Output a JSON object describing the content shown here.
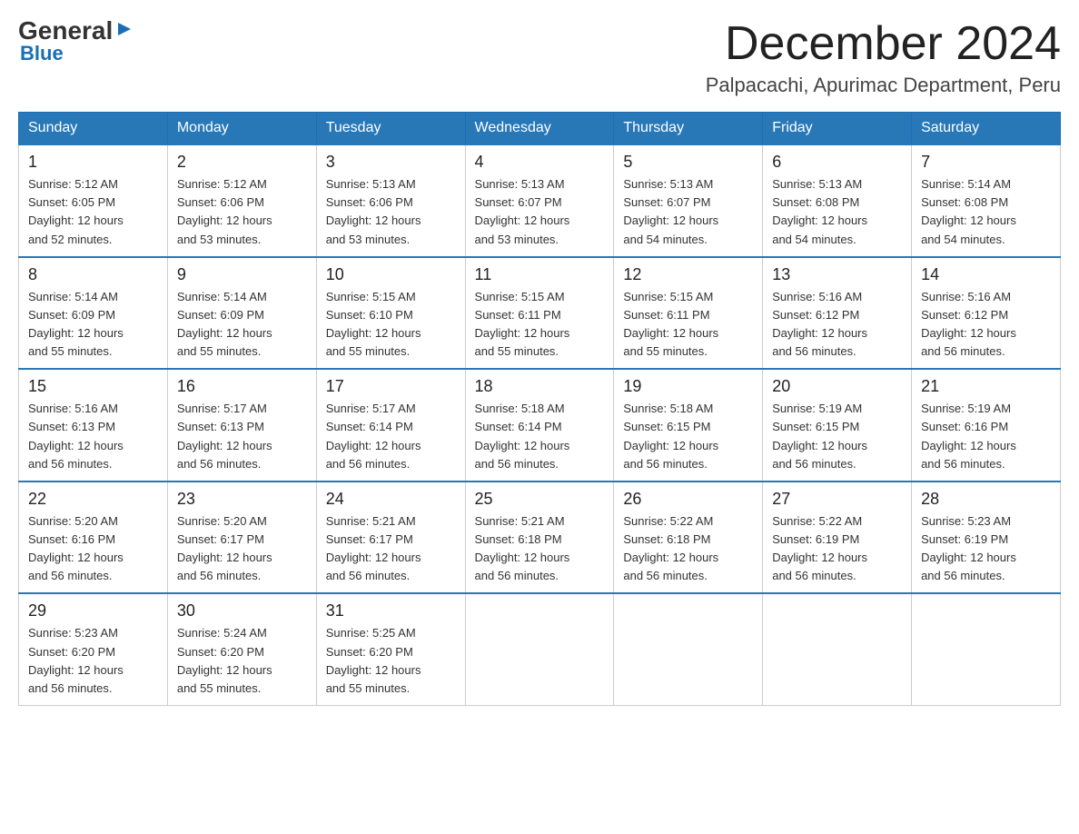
{
  "header": {
    "logo_general": "General",
    "logo_blue": "Blue",
    "month_title": "December 2024",
    "location": "Palpacachi, Apurimac Department, Peru"
  },
  "weekdays": [
    "Sunday",
    "Monday",
    "Tuesday",
    "Wednesday",
    "Thursday",
    "Friday",
    "Saturday"
  ],
  "weeks": [
    [
      {
        "day": "1",
        "sunrise": "5:12 AM",
        "sunset": "6:05 PM",
        "daylight": "12 hours and 52 minutes."
      },
      {
        "day": "2",
        "sunrise": "5:12 AM",
        "sunset": "6:06 PM",
        "daylight": "12 hours and 53 minutes."
      },
      {
        "day": "3",
        "sunrise": "5:13 AM",
        "sunset": "6:06 PM",
        "daylight": "12 hours and 53 minutes."
      },
      {
        "day": "4",
        "sunrise": "5:13 AM",
        "sunset": "6:07 PM",
        "daylight": "12 hours and 53 minutes."
      },
      {
        "day": "5",
        "sunrise": "5:13 AM",
        "sunset": "6:07 PM",
        "daylight": "12 hours and 54 minutes."
      },
      {
        "day": "6",
        "sunrise": "5:13 AM",
        "sunset": "6:08 PM",
        "daylight": "12 hours and 54 minutes."
      },
      {
        "day": "7",
        "sunrise": "5:14 AM",
        "sunset": "6:08 PM",
        "daylight": "12 hours and 54 minutes."
      }
    ],
    [
      {
        "day": "8",
        "sunrise": "5:14 AM",
        "sunset": "6:09 PM",
        "daylight": "12 hours and 55 minutes."
      },
      {
        "day": "9",
        "sunrise": "5:14 AM",
        "sunset": "6:09 PM",
        "daylight": "12 hours and 55 minutes."
      },
      {
        "day": "10",
        "sunrise": "5:15 AM",
        "sunset": "6:10 PM",
        "daylight": "12 hours and 55 minutes."
      },
      {
        "day": "11",
        "sunrise": "5:15 AM",
        "sunset": "6:11 PM",
        "daylight": "12 hours and 55 minutes."
      },
      {
        "day": "12",
        "sunrise": "5:15 AM",
        "sunset": "6:11 PM",
        "daylight": "12 hours and 55 minutes."
      },
      {
        "day": "13",
        "sunrise": "5:16 AM",
        "sunset": "6:12 PM",
        "daylight": "12 hours and 56 minutes."
      },
      {
        "day": "14",
        "sunrise": "5:16 AM",
        "sunset": "6:12 PM",
        "daylight": "12 hours and 56 minutes."
      }
    ],
    [
      {
        "day": "15",
        "sunrise": "5:16 AM",
        "sunset": "6:13 PM",
        "daylight": "12 hours and 56 minutes."
      },
      {
        "day": "16",
        "sunrise": "5:17 AM",
        "sunset": "6:13 PM",
        "daylight": "12 hours and 56 minutes."
      },
      {
        "day": "17",
        "sunrise": "5:17 AM",
        "sunset": "6:14 PM",
        "daylight": "12 hours and 56 minutes."
      },
      {
        "day": "18",
        "sunrise": "5:18 AM",
        "sunset": "6:14 PM",
        "daylight": "12 hours and 56 minutes."
      },
      {
        "day": "19",
        "sunrise": "5:18 AM",
        "sunset": "6:15 PM",
        "daylight": "12 hours and 56 minutes."
      },
      {
        "day": "20",
        "sunrise": "5:19 AM",
        "sunset": "6:15 PM",
        "daylight": "12 hours and 56 minutes."
      },
      {
        "day": "21",
        "sunrise": "5:19 AM",
        "sunset": "6:16 PM",
        "daylight": "12 hours and 56 minutes."
      }
    ],
    [
      {
        "day": "22",
        "sunrise": "5:20 AM",
        "sunset": "6:16 PM",
        "daylight": "12 hours and 56 minutes."
      },
      {
        "day": "23",
        "sunrise": "5:20 AM",
        "sunset": "6:17 PM",
        "daylight": "12 hours and 56 minutes."
      },
      {
        "day": "24",
        "sunrise": "5:21 AM",
        "sunset": "6:17 PM",
        "daylight": "12 hours and 56 minutes."
      },
      {
        "day": "25",
        "sunrise": "5:21 AM",
        "sunset": "6:18 PM",
        "daylight": "12 hours and 56 minutes."
      },
      {
        "day": "26",
        "sunrise": "5:22 AM",
        "sunset": "6:18 PM",
        "daylight": "12 hours and 56 minutes."
      },
      {
        "day": "27",
        "sunrise": "5:22 AM",
        "sunset": "6:19 PM",
        "daylight": "12 hours and 56 minutes."
      },
      {
        "day": "28",
        "sunrise": "5:23 AM",
        "sunset": "6:19 PM",
        "daylight": "12 hours and 56 minutes."
      }
    ],
    [
      {
        "day": "29",
        "sunrise": "5:23 AM",
        "sunset": "6:20 PM",
        "daylight": "12 hours and 56 minutes."
      },
      {
        "day": "30",
        "sunrise": "5:24 AM",
        "sunset": "6:20 PM",
        "daylight": "12 hours and 55 minutes."
      },
      {
        "day": "31",
        "sunrise": "5:25 AM",
        "sunset": "6:20 PM",
        "daylight": "12 hours and 55 minutes."
      },
      null,
      null,
      null,
      null
    ]
  ],
  "labels": {
    "sunrise": "Sunrise:",
    "sunset": "Sunset:",
    "daylight": "Daylight:"
  }
}
